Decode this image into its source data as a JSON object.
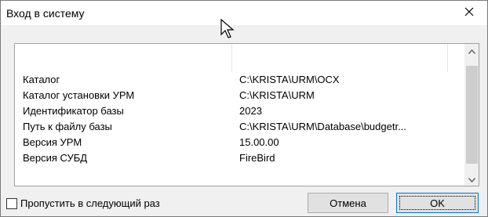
{
  "window": {
    "title": "Вход в систему"
  },
  "info": {
    "rows": [
      {
        "key": "Каталог",
        "value": "C:\\KRISTA\\URM\\OCX"
      },
      {
        "key": "Каталог установки УРМ",
        "value": "C:\\KRISTA\\URM"
      },
      {
        "key": "Идентификатор базы",
        "value": "2023"
      },
      {
        "key": "Путь к файлу базы",
        "value": "C:\\KRISTA\\URM\\Database\\budgetr..."
      },
      {
        "key": "Версия УРМ",
        "value": "15.00.00"
      },
      {
        "key": "Версия СУБД",
        "value": "FireBird"
      }
    ]
  },
  "footer": {
    "skip_label": "Пропустить в следующий раз",
    "skip_checked": false,
    "cancel_label": "Отмена",
    "ok_label": "OK"
  },
  "icons": {
    "close": "close-icon",
    "cursor": "mouse-pointer-icon",
    "scroll_up": "chevron-up-icon",
    "scroll_down": "chevron-down-icon"
  }
}
